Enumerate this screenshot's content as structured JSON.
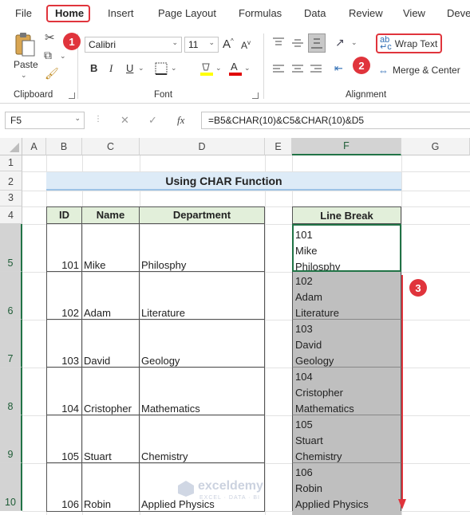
{
  "menu": {
    "tabs": [
      "File",
      "Home",
      "Insert",
      "Page Layout",
      "Formulas",
      "Data",
      "Review",
      "View",
      "Deve"
    ]
  },
  "ribbon": {
    "clipboard": {
      "paste_label": "Paste",
      "group_label": "Clipboard"
    },
    "font": {
      "font_name": "Calibri",
      "font_size": "11",
      "group_label": "Font",
      "bold": "B",
      "italic": "I",
      "underline": "U"
    },
    "alignment": {
      "wrap_text_label": "Wrap Text",
      "merge_center_label": "Merge & Center",
      "group_label": "Alignment"
    }
  },
  "badges": {
    "one": "1",
    "two": "2",
    "three": "3"
  },
  "formula_bar": {
    "name_box": "F5",
    "fx": "fx",
    "formula": "=B5&CHAR(10)&C5&CHAR(10)&D5"
  },
  "sheet": {
    "columns": [
      "A",
      "B",
      "C",
      "D",
      "E",
      "F",
      "G"
    ],
    "rows": [
      "1",
      "2",
      "3",
      "4",
      "5",
      "6",
      "7",
      "8",
      "9",
      "10"
    ],
    "title": "Using CHAR Function",
    "headers": {
      "id": "ID",
      "name": "Name",
      "department": "Department",
      "line_break": "Line Break"
    },
    "records": [
      {
        "id": "101",
        "name": "Mike",
        "department": "Philosphy",
        "lb1": "101",
        "lb2": "Mike",
        "lb3": "Philosphy"
      },
      {
        "id": "102",
        "name": "Adam",
        "department": "Literature",
        "lb1": "102",
        "lb2": "Adam",
        "lb3": "Literature"
      },
      {
        "id": "103",
        "name": "David",
        "department": "Geology",
        "lb1": "103",
        "lb2": "David",
        "lb3": "Geology"
      },
      {
        "id": "104",
        "name": "Cristopher",
        "department": "Mathematics",
        "lb1": "104",
        "lb2": "Cristopher",
        "lb3": "Mathematics"
      },
      {
        "id": "105",
        "name": "Stuart",
        "department": "Chemistry",
        "lb1": "105",
        "lb2": "Stuart",
        "lb3": "Chemistry"
      },
      {
        "id": "106",
        "name": "Robin",
        "department": "Applied Physics",
        "lb1": "106",
        "lb2": "Robin",
        "lb3": "Applied Physics"
      }
    ]
  },
  "watermark": {
    "name": "exceldemy",
    "tagline": "EXCEL · DATA · BI"
  },
  "colors": {
    "accent": "#e0343c",
    "header_fill": "#e2efda",
    "title_fill": "#ddebf7",
    "selection": "#bfbfbf",
    "green": "#217346"
  }
}
